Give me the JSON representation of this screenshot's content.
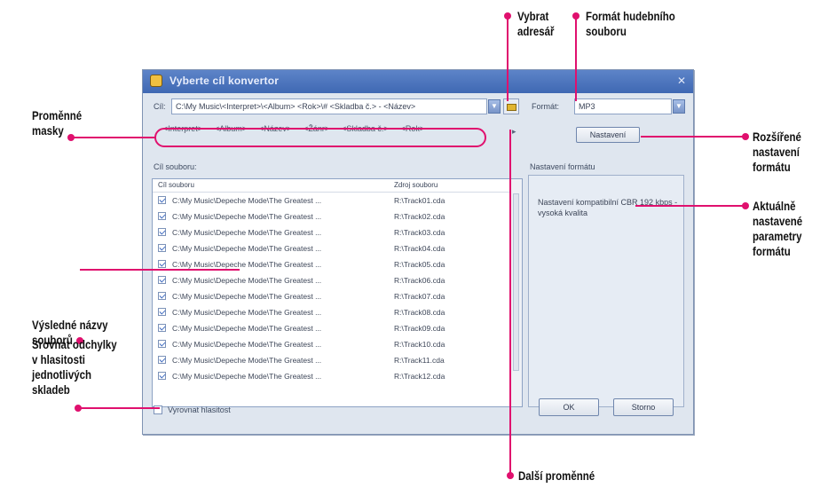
{
  "dialog": {
    "title": "Vyberte cíl konvertor",
    "target_label": "Cíl:",
    "target_value": "C:\\My Music\\<Interpret>\\<Album> <Rok>\\# <Skladba č.> - <Název>",
    "format_label": "Formát:",
    "format_value": "MP3",
    "mask_tags": [
      "<Interpret>",
      "<Album>",
      "<Název>",
      "<Žánr>",
      "<Skladba č.>",
      "<Rok>"
    ],
    "settings_button": "Nastavení",
    "files_group_label": "Cíl souboru:",
    "col_target": "Cíl souboru",
    "col_source": "Zdroj souboru",
    "rows": [
      {
        "path": "C:\\My Music\\Depeche Mode\\The Greatest ...",
        "source": "R:\\Track01.cda"
      },
      {
        "path": "C:\\My Music\\Depeche Mode\\The Greatest ...",
        "source": "R:\\Track02.cda"
      },
      {
        "path": "C:\\My Music\\Depeche Mode\\The Greatest ...",
        "source": "R:\\Track03.cda"
      },
      {
        "path": "C:\\My Music\\Depeche Mode\\The Greatest ...",
        "source": "R:\\Track04.cda"
      },
      {
        "path": "C:\\My Music\\Depeche Mode\\The Greatest ...",
        "source": "R:\\Track05.cda"
      },
      {
        "path": "C:\\My Music\\Depeche Mode\\The Greatest ...",
        "source": "R:\\Track06.cda"
      },
      {
        "path": "C:\\My Music\\Depeche Mode\\The Greatest ...",
        "source": "R:\\Track07.cda"
      },
      {
        "path": "C:\\My Music\\Depeche Mode\\The Greatest ...",
        "source": "R:\\Track08.cda"
      },
      {
        "path": "C:\\My Music\\Depeche Mode\\The Greatest ...",
        "source": "R:\\Track09.cda"
      },
      {
        "path": "C:\\My Music\\Depeche Mode\\The Greatest ...",
        "source": "R:\\Track10.cda"
      },
      {
        "path": "C:\\My Music\\Depeche Mode\\The Greatest ...",
        "source": "R:\\Track11.cda"
      },
      {
        "path": "C:\\My Music\\Depeche Mode\\The Greatest ...",
        "source": "R:\\Track12.cda"
      }
    ],
    "format_settings_label": "Nastavení formátu",
    "format_settings_text": "Nastavení kompatibilní CBR 192 kbps - vysoká kvalita",
    "normalize_label": "Vyrovnat hlasitost",
    "ok_button": "OK",
    "cancel_button": "Storno"
  },
  "annotations": {
    "select_dir": "Vybrat adresář",
    "music_format": "Formát hudebního souboru",
    "mask_vars": "Proměnné masky",
    "advanced_format": "Rozšířené nastavení formátu",
    "current_params": "Aktuálně nastavené parametry formátu",
    "result_names": "Výsledné názvy souborů",
    "normalize": "Srovnat odchylky v hlasitosti jednotlivých skladeb",
    "more_vars": "Další proměnné"
  },
  "colors": {
    "accent": "#e0106e",
    "titlebar": "#4a73bd"
  }
}
